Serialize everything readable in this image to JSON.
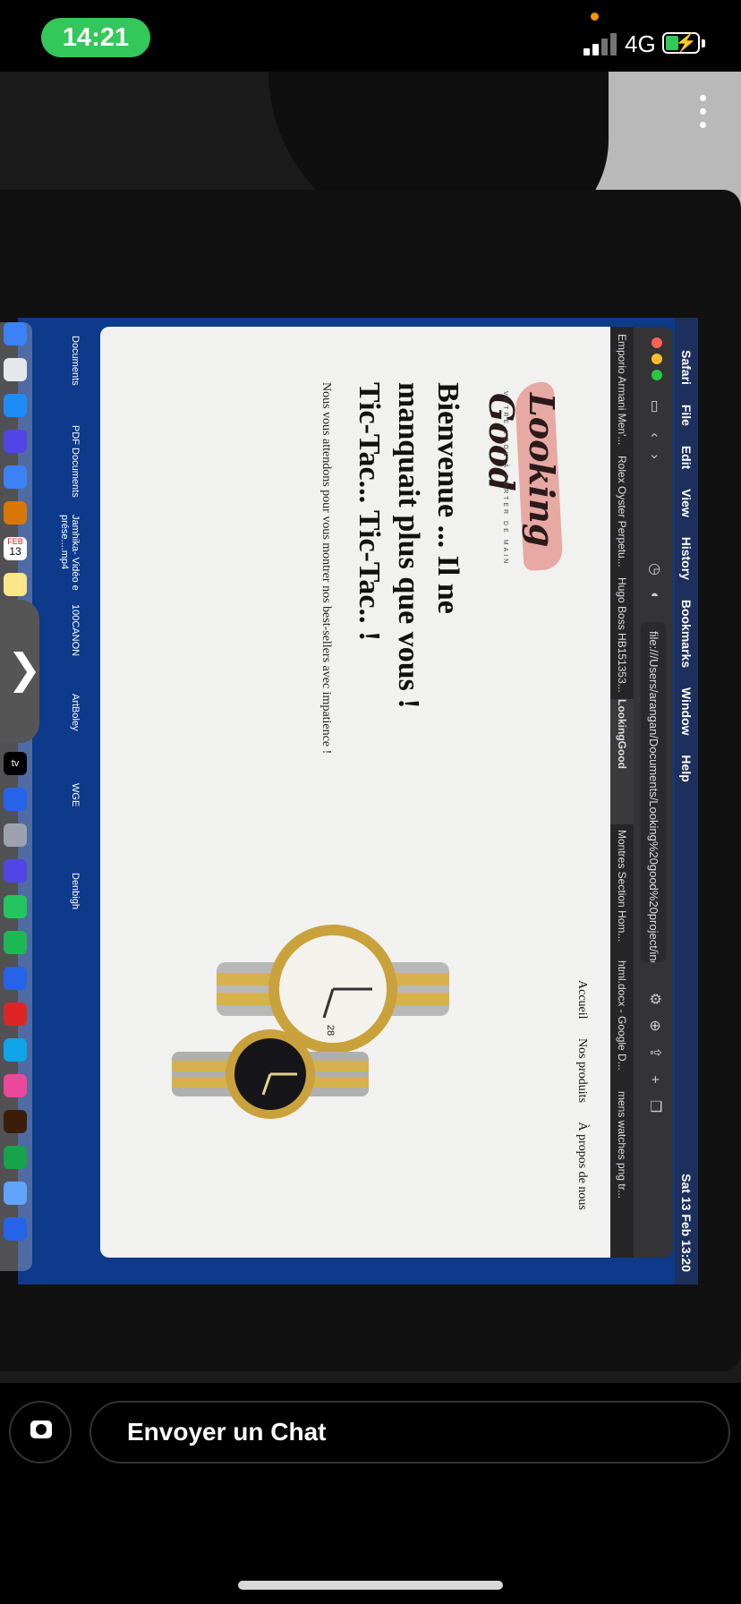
{
  "status_bar": {
    "time": "14:21",
    "network": "4G"
  },
  "menubar": {
    "items": [
      "Safari",
      "File",
      "Edit",
      "View",
      "History",
      "Bookmarks",
      "Window",
      "Help"
    ],
    "datetime": "Sat 13 Feb  13:20"
  },
  "browser": {
    "url": "file:///Users/arangan/Documents/Looking%20good%20project/index.html",
    "tabs": [
      "Emporio Armani Men'...",
      "Rolex Oyster Perpetu...",
      "Hugo Boss HB151353...",
      "LookingGood",
      "Montres Section Hom...",
      "html.docx - Google D...",
      "mens watches png tr..."
    ]
  },
  "page": {
    "logo": "Looking Good",
    "logo_tagline": "VOTRE LOOK À PORTER DE MAIN",
    "nav": [
      "Accueil",
      "Nos produits",
      "À propos de nous"
    ],
    "hero_line1": "Bienvenue ... Il ne",
    "hero_line2": "manquait plus que vous !",
    "hero_line3": "Tic-Tac... Tic-Tac.. !",
    "subtitle": "Nous vous attendons pour vous montrer nos best-sellers avec impatience !",
    "watch_date": "28"
  },
  "desktop": {
    "items": [
      "Documents",
      "PDF Documents",
      "Jamhika- Vidéo e prése....mp4",
      "100CANON",
      "ArtBoley",
      "WGE",
      "Denbigh"
    ]
  },
  "dock": {
    "calendar_day": "13",
    "calendar_month": "FEB",
    "tv_label": "tv"
  },
  "chat": {
    "placeholder": "Envoyer un Chat"
  },
  "colors": {
    "status_green": "#34c759",
    "logo_pink": "#e7a9a3",
    "page_bg": "#f1f1ef"
  }
}
